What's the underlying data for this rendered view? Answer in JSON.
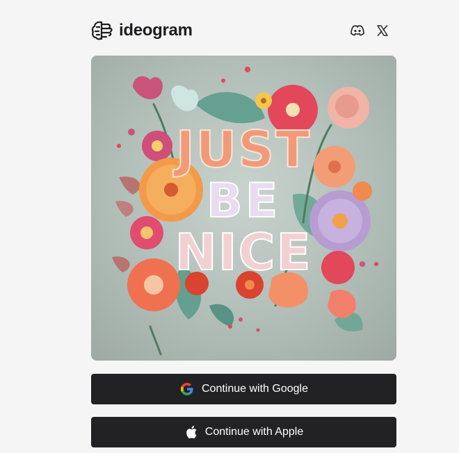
{
  "header": {
    "brand_name": "ideogram",
    "logo_icon": "ideogram-brain-icon",
    "social_links": [
      {
        "icon": "discord-icon"
      },
      {
        "icon": "x-icon"
      }
    ]
  },
  "hero": {
    "artwork_text_line1": "JUST",
    "artwork_text_line2": "BE",
    "artwork_text_line3": "NICE"
  },
  "auth": {
    "google_label": "Continue with Google",
    "google_icon": "google-icon",
    "apple_label": "Continue with Apple",
    "apple_icon": "apple-icon"
  },
  "colors": {
    "page_background": "#f5f5f5",
    "button_background": "#222224",
    "button_text": "#ffffff",
    "brand_text": "#1d1d1f"
  }
}
